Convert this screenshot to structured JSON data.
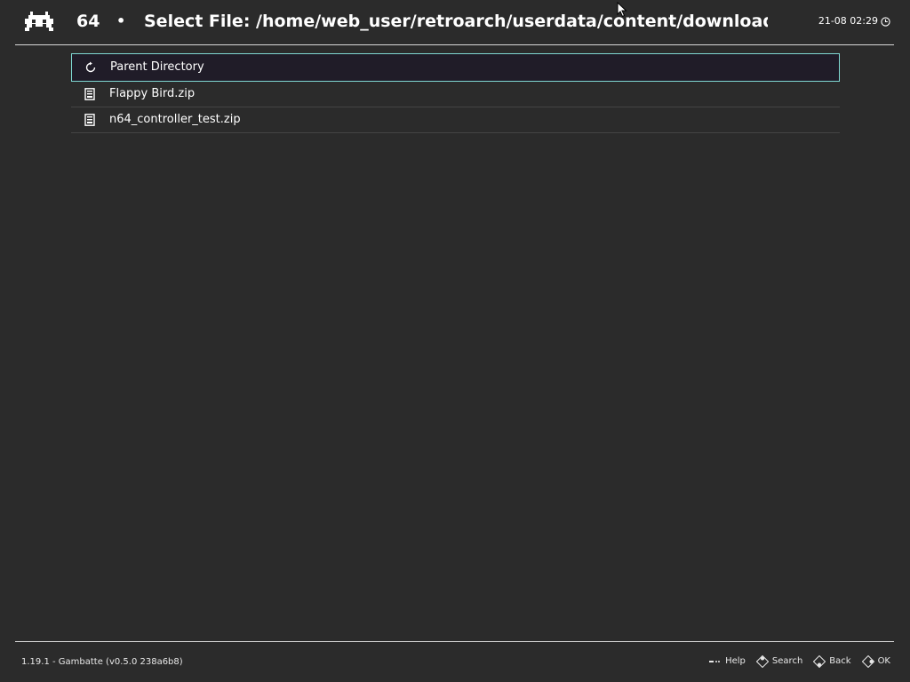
{
  "header": {
    "core_name": "64",
    "separator": "•",
    "title": "Select File: /home/web_user/retroarch/userdata/content/downloads/Nint",
    "clock": "21-08 02:29"
  },
  "file_list": {
    "items": [
      {
        "label": "Parent Directory",
        "icon": "parent-directory-icon",
        "selected": true
      },
      {
        "label": "Flappy Bird.zip",
        "icon": "file-icon",
        "selected": false
      },
      {
        "label": "n64_controller_test.zip",
        "icon": "file-icon",
        "selected": false
      }
    ]
  },
  "footer": {
    "version": "1.19.1 - Gambatte (v0.5.0 238a6b8)",
    "actions": {
      "help": "Help",
      "search": "Search",
      "back": "Back",
      "ok": "OK"
    }
  },
  "colors": {
    "background": "#2b2b2b",
    "selection_border": "#7fd8d2",
    "selection_fill": "#201c28",
    "text": "#ffffff"
  }
}
